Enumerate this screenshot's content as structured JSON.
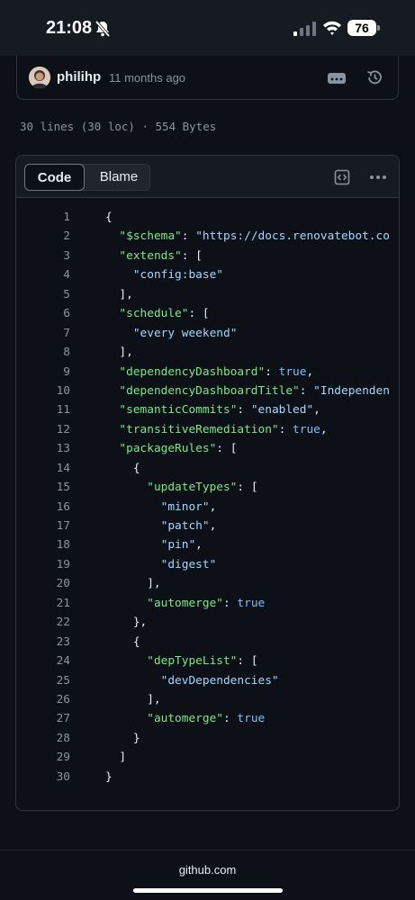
{
  "status_bar": {
    "time": "21:08",
    "battery": "76"
  },
  "commit": {
    "author": "philihp",
    "time_ago": "11 months ago"
  },
  "file_info": "30 lines (30 loc) · 554 Bytes",
  "code_view": {
    "tabs": [
      {
        "label": "Code",
        "selected": true
      },
      {
        "label": "Blame",
        "selected": false
      }
    ]
  },
  "code_lines": [
    {
      "number": "1",
      "tokens": [
        {
          "t": "{",
          "c": "p"
        }
      ]
    },
    {
      "number": "2",
      "tokens": [
        {
          "t": "  ",
          "c": "p"
        },
        {
          "t": "\"$schema\"",
          "c": "k"
        },
        {
          "t": ": ",
          "c": "p"
        },
        {
          "t": "\"https://docs.renovatebot.co",
          "c": "s"
        }
      ]
    },
    {
      "number": "3",
      "tokens": [
        {
          "t": "  ",
          "c": "p"
        },
        {
          "t": "\"extends\"",
          "c": "k"
        },
        {
          "t": ": [",
          "c": "p"
        }
      ]
    },
    {
      "number": "4",
      "tokens": [
        {
          "t": "    ",
          "c": "p"
        },
        {
          "t": "\"config:base\"",
          "c": "s"
        }
      ]
    },
    {
      "number": "5",
      "tokens": [
        {
          "t": "  ],",
          "c": "p"
        }
      ]
    },
    {
      "number": "6",
      "tokens": [
        {
          "t": "  ",
          "c": "p"
        },
        {
          "t": "\"schedule\"",
          "c": "k"
        },
        {
          "t": ": [",
          "c": "p"
        }
      ]
    },
    {
      "number": "7",
      "tokens": [
        {
          "t": "    ",
          "c": "p"
        },
        {
          "t": "\"every weekend\"",
          "c": "s"
        }
      ]
    },
    {
      "number": "8",
      "tokens": [
        {
          "t": "  ],",
          "c": "p"
        }
      ]
    },
    {
      "number": "9",
      "tokens": [
        {
          "t": "  ",
          "c": "p"
        },
        {
          "t": "\"dependencyDashboard\"",
          "c": "k"
        },
        {
          "t": ": ",
          "c": "p"
        },
        {
          "t": "true",
          "c": "b"
        },
        {
          "t": ",",
          "c": "p"
        }
      ]
    },
    {
      "number": "10",
      "tokens": [
        {
          "t": "  ",
          "c": "p"
        },
        {
          "t": "\"dependencyDashboardTitle\"",
          "c": "k"
        },
        {
          "t": ": ",
          "c": "p"
        },
        {
          "t": "\"Independen",
          "c": "s"
        }
      ]
    },
    {
      "number": "11",
      "tokens": [
        {
          "t": "  ",
          "c": "p"
        },
        {
          "t": "\"semanticCommits\"",
          "c": "k"
        },
        {
          "t": ": ",
          "c": "p"
        },
        {
          "t": "\"enabled\"",
          "c": "s"
        },
        {
          "t": ",",
          "c": "p"
        }
      ]
    },
    {
      "number": "12",
      "tokens": [
        {
          "t": "  ",
          "c": "p"
        },
        {
          "t": "\"transitiveRemediation\"",
          "c": "k"
        },
        {
          "t": ": ",
          "c": "p"
        },
        {
          "t": "true",
          "c": "b"
        },
        {
          "t": ",",
          "c": "p"
        }
      ]
    },
    {
      "number": "13",
      "tokens": [
        {
          "t": "  ",
          "c": "p"
        },
        {
          "t": "\"packageRules\"",
          "c": "k"
        },
        {
          "t": ": [",
          "c": "p"
        }
      ]
    },
    {
      "number": "14",
      "tokens": [
        {
          "t": "    {",
          "c": "p"
        }
      ]
    },
    {
      "number": "15",
      "tokens": [
        {
          "t": "      ",
          "c": "p"
        },
        {
          "t": "\"updateTypes\"",
          "c": "k"
        },
        {
          "t": ": [",
          "c": "p"
        }
      ]
    },
    {
      "number": "16",
      "tokens": [
        {
          "t": "        ",
          "c": "p"
        },
        {
          "t": "\"minor\"",
          "c": "s"
        },
        {
          "t": ",",
          "c": "p"
        }
      ]
    },
    {
      "number": "17",
      "tokens": [
        {
          "t": "        ",
          "c": "p"
        },
        {
          "t": "\"patch\"",
          "c": "s"
        },
        {
          "t": ",",
          "c": "p"
        }
      ]
    },
    {
      "number": "18",
      "tokens": [
        {
          "t": "        ",
          "c": "p"
        },
        {
          "t": "\"pin\"",
          "c": "s"
        },
        {
          "t": ",",
          "c": "p"
        }
      ]
    },
    {
      "number": "19",
      "tokens": [
        {
          "t": "        ",
          "c": "p"
        },
        {
          "t": "\"digest\"",
          "c": "s"
        }
      ]
    },
    {
      "number": "20",
      "tokens": [
        {
          "t": "      ],",
          "c": "p"
        }
      ]
    },
    {
      "number": "21",
      "tokens": [
        {
          "t": "      ",
          "c": "p"
        },
        {
          "t": "\"automerge\"",
          "c": "k"
        },
        {
          "t": ": ",
          "c": "p"
        },
        {
          "t": "true",
          "c": "b"
        }
      ]
    },
    {
      "number": "22",
      "tokens": [
        {
          "t": "    },",
          "c": "p"
        }
      ]
    },
    {
      "number": "23",
      "tokens": [
        {
          "t": "    {",
          "c": "p"
        }
      ]
    },
    {
      "number": "24",
      "tokens": [
        {
          "t": "      ",
          "c": "p"
        },
        {
          "t": "\"depTypeList\"",
          "c": "k"
        },
        {
          "t": ": [",
          "c": "p"
        }
      ]
    },
    {
      "number": "25",
      "tokens": [
        {
          "t": "        ",
          "c": "p"
        },
        {
          "t": "\"devDependencies\"",
          "c": "s"
        }
      ]
    },
    {
      "number": "26",
      "tokens": [
        {
          "t": "      ],",
          "c": "p"
        }
      ]
    },
    {
      "number": "27",
      "tokens": [
        {
          "t": "      ",
          "c": "p"
        },
        {
          "t": "\"automerge\"",
          "c": "k"
        },
        {
          "t": ": ",
          "c": "p"
        },
        {
          "t": "true",
          "c": "b"
        }
      ]
    },
    {
      "number": "28",
      "tokens": [
        {
          "t": "    }",
          "c": "p"
        }
      ]
    },
    {
      "number": "29",
      "tokens": [
        {
          "t": "  ]",
          "c": "p"
        }
      ]
    },
    {
      "number": "30",
      "tokens": [
        {
          "t": "}",
          "c": "p"
        }
      ]
    }
  ],
  "footer": {
    "url": "github.com"
  },
  "colors": {
    "background": "#0d1117",
    "key": "#7ee787",
    "string": "#a5d6ff",
    "boolean": "#79c0ff",
    "punctuation": "#e6edf3",
    "line_number": "#8b949e"
  },
  "icons": {
    "status": [
      "bell-slash-icon",
      "cellular-signal-icon",
      "wifi-icon",
      "battery-icon"
    ],
    "commit": [
      "kebab-icon",
      "history-icon"
    ],
    "code_header": [
      "code-square-icon",
      "more-horizontal-icon"
    ]
  }
}
